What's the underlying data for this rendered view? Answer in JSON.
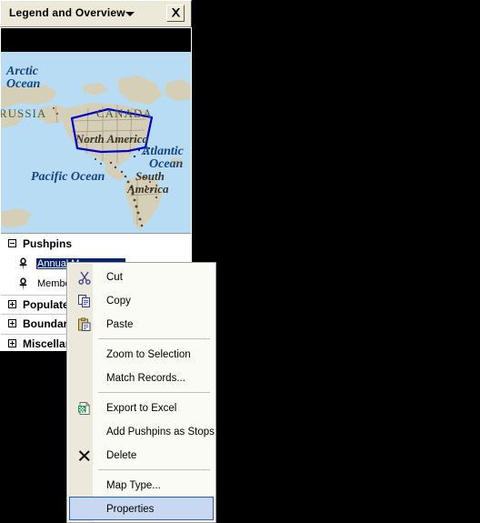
{
  "window": {
    "title": "Legend and Overview",
    "dropdown_icon": "chevron-down-icon",
    "close_icon": "close-icon",
    "close_label": "X"
  },
  "overview_map": {
    "labels": [
      {
        "text": "Arctic",
        "type": "ocean"
      },
      {
        "text": "Ocean",
        "type": "ocean"
      },
      {
        "text": "RUSSIA",
        "type": "country"
      },
      {
        "text": "CANADA",
        "type": "country"
      },
      {
        "text": "North America",
        "type": "continent"
      },
      {
        "text": "Atlantic",
        "type": "ocean"
      },
      {
        "text": "Ocean",
        "type": "ocean"
      },
      {
        "text": "Pacific Ocean",
        "type": "ocean"
      },
      {
        "text": "South",
        "type": "continent"
      },
      {
        "text": "America",
        "type": "continent"
      }
    ],
    "colors": {
      "ocean": "#b7dcf4",
      "land": "#d5cfb8",
      "selection_outline": "#0000cd",
      "ocean_label": "#16447e",
      "country_label": "#4a5c42"
    },
    "selection_shape": "current-view-extent-polygon"
  },
  "legend": {
    "groups": [
      {
        "label": "Pushpins",
        "expanded": true,
        "expander_icon": "minus-box-icon",
        "items": [
          {
            "label": "Annual M",
            "icon": "pushpin-icon",
            "selected": true
          },
          {
            "label": "Membe",
            "icon": "pushpin-icon",
            "selected": false
          }
        ]
      },
      {
        "label": "Populated",
        "expanded": false,
        "expander_icon": "plus-box-icon",
        "items": []
      },
      {
        "label": "Boundarie",
        "expanded": false,
        "expander_icon": "plus-box-icon",
        "items": []
      },
      {
        "label": "Miscellan",
        "expanded": false,
        "expander_icon": "plus-box-icon",
        "items": []
      }
    ]
  },
  "context_menu": {
    "items": [
      {
        "label": "Cut",
        "accel": "t",
        "icon": "scissors-icon",
        "type": "item",
        "highlighted": false
      },
      {
        "label": "Copy",
        "accel": "C",
        "icon": "copy-icon",
        "type": "item",
        "highlighted": false
      },
      {
        "label": "Paste",
        "accel": "P",
        "icon": "paste-icon",
        "type": "item",
        "highlighted": false
      },
      {
        "type": "separator"
      },
      {
        "label": "Zoom to Selection",
        "accel": "Z",
        "icon": "",
        "type": "item",
        "highlighted": false
      },
      {
        "label": "Match Records...",
        "accel": "o",
        "icon": "",
        "type": "item",
        "highlighted": false
      },
      {
        "type": "separator"
      },
      {
        "label": "Export to Excel",
        "accel": "E",
        "icon": "excel-icon",
        "type": "item",
        "highlighted": false
      },
      {
        "label": "Add Pushpins as Stops",
        "accel": "A",
        "icon": "",
        "type": "item",
        "highlighted": false
      },
      {
        "label": "Delete",
        "accel": "D",
        "icon": "delete-x-icon",
        "type": "item",
        "highlighted": false
      },
      {
        "type": "separator"
      },
      {
        "label": "Map Type...",
        "accel": "y",
        "icon": "",
        "type": "item",
        "highlighted": false
      },
      {
        "label": "Properties",
        "accel": "r",
        "icon": "",
        "type": "item",
        "highlighted": true
      }
    ],
    "highlight_color": "#c8d8f0",
    "highlight_border": "#2a5bb8"
  }
}
